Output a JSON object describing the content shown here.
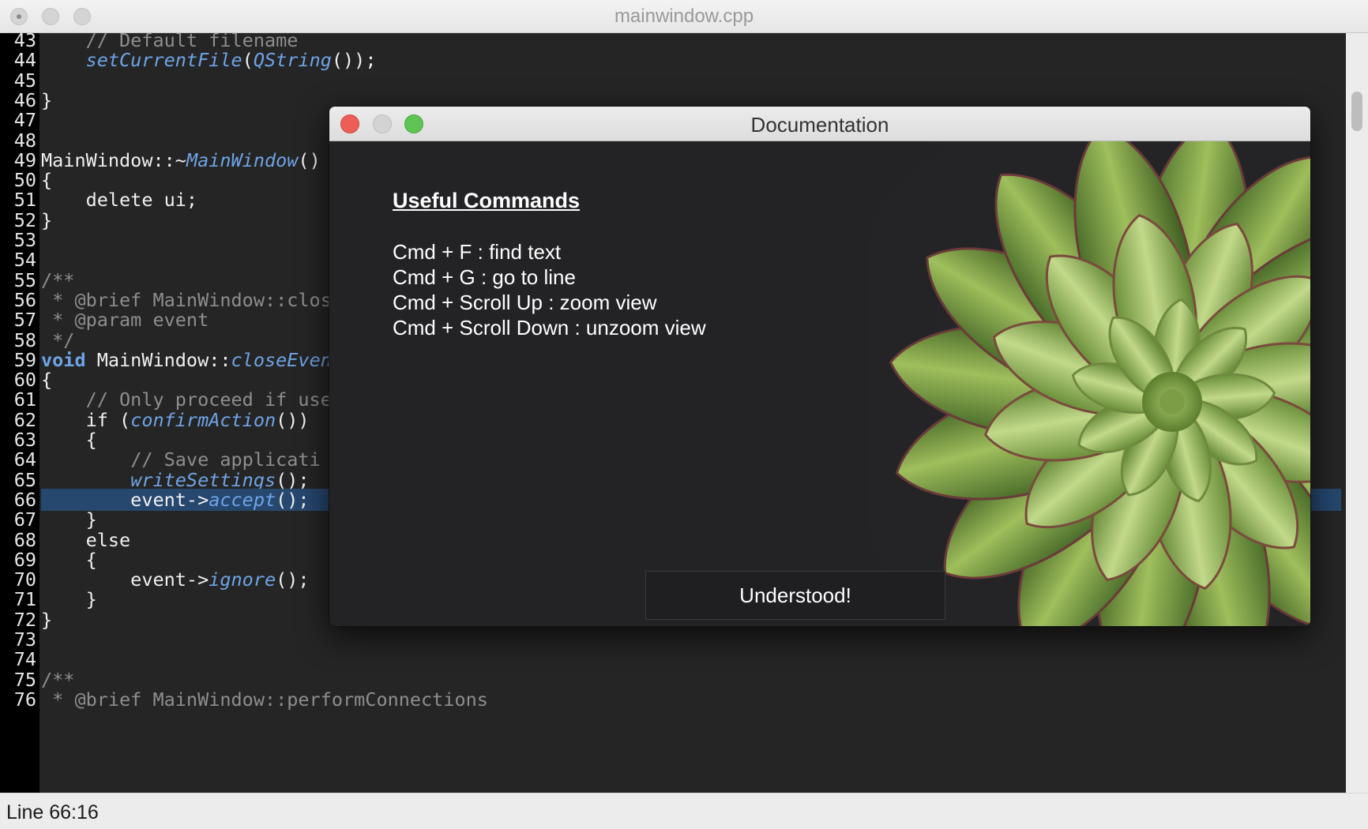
{
  "window": {
    "title": "mainwindow.cpp"
  },
  "editor": {
    "current_line": "66",
    "lines": [
      {
        "n": "43",
        "tokens": [
          [
            "plain",
            "    "
          ],
          [
            "comment",
            "// Default filename"
          ]
        ]
      },
      {
        "n": "44",
        "tokens": [
          [
            "plain",
            "    "
          ],
          [
            "fn",
            "setCurrentFile"
          ],
          [
            "plain",
            "("
          ],
          [
            "fn",
            "QString"
          ],
          [
            "plain",
            "());"
          ]
        ]
      },
      {
        "n": "45",
        "tokens": []
      },
      {
        "n": "46",
        "tokens": [
          [
            "plain",
            "}"
          ]
        ]
      },
      {
        "n": "47",
        "tokens": []
      },
      {
        "n": "48",
        "tokens": []
      },
      {
        "n": "49",
        "tokens": [
          [
            "plain",
            "MainWindow::~"
          ],
          [
            "fn",
            "MainWindow"
          ],
          [
            "plain",
            "()"
          ]
        ]
      },
      {
        "n": "50",
        "tokens": [
          [
            "plain",
            "{"
          ]
        ]
      },
      {
        "n": "51",
        "tokens": [
          [
            "plain",
            "    delete ui;"
          ]
        ]
      },
      {
        "n": "52",
        "tokens": [
          [
            "plain",
            "}"
          ]
        ]
      },
      {
        "n": "53",
        "tokens": []
      },
      {
        "n": "54",
        "tokens": []
      },
      {
        "n": "55",
        "tokens": [
          [
            "comment",
            "/**"
          ]
        ]
      },
      {
        "n": "56",
        "tokens": [
          [
            "comment",
            " * @brief MainWindow::clos"
          ]
        ]
      },
      {
        "n": "57",
        "tokens": [
          [
            "comment",
            " * @param event"
          ]
        ]
      },
      {
        "n": "58",
        "tokens": [
          [
            "comment",
            " */"
          ]
        ]
      },
      {
        "n": "59",
        "tokens": [
          [
            "kw",
            "void"
          ],
          [
            "plain",
            " MainWindow::"
          ],
          [
            "fn",
            "closeEven"
          ]
        ]
      },
      {
        "n": "60",
        "tokens": [
          [
            "plain",
            "{"
          ]
        ]
      },
      {
        "n": "61",
        "tokens": [
          [
            "plain",
            "    "
          ],
          [
            "comment",
            "// Only proceed if use"
          ]
        ]
      },
      {
        "n": "62",
        "tokens": [
          [
            "plain",
            "    if ("
          ],
          [
            "fn",
            "confirmAction"
          ],
          [
            "plain",
            "())"
          ]
        ]
      },
      {
        "n": "63",
        "tokens": [
          [
            "plain",
            "    {"
          ]
        ]
      },
      {
        "n": "64",
        "tokens": [
          [
            "plain",
            "        "
          ],
          [
            "comment",
            "// Save applicati"
          ]
        ]
      },
      {
        "n": "65",
        "tokens": [
          [
            "plain",
            "        "
          ],
          [
            "fn",
            "writeSettings"
          ],
          [
            "plain",
            "();"
          ]
        ]
      },
      {
        "n": "66",
        "tokens": [
          [
            "plain",
            "        event->"
          ],
          [
            "fn",
            "accept"
          ],
          [
            "plain",
            "();"
          ]
        ]
      },
      {
        "n": "67",
        "tokens": [
          [
            "plain",
            "    }"
          ]
        ]
      },
      {
        "n": "68",
        "tokens": [
          [
            "plain",
            "    else"
          ]
        ]
      },
      {
        "n": "69",
        "tokens": [
          [
            "plain",
            "    {"
          ]
        ]
      },
      {
        "n": "70",
        "tokens": [
          [
            "plain",
            "        event->"
          ],
          [
            "fn",
            "ignore"
          ],
          [
            "plain",
            "();"
          ]
        ]
      },
      {
        "n": "71",
        "tokens": [
          [
            "plain",
            "    }"
          ]
        ]
      },
      {
        "n": "72",
        "tokens": [
          [
            "plain",
            "}"
          ]
        ]
      },
      {
        "n": "73",
        "tokens": []
      },
      {
        "n": "74",
        "tokens": []
      },
      {
        "n": "75",
        "tokens": [
          [
            "comment",
            "/**"
          ]
        ]
      },
      {
        "n": "76",
        "tokens": [
          [
            "comment",
            " * @brief MainWindow::performConnections"
          ]
        ]
      }
    ]
  },
  "status_bar": {
    "text": "Line 66:16"
  },
  "dialog": {
    "title": "Documentation",
    "heading": "Useful Commands",
    "commands": [
      "Cmd + F : find text",
      "Cmd + G : go to line",
      "Cmd + Scroll Up : zoom view",
      "Cmd + Scroll Down : unzoom view"
    ],
    "button_label": "Understood!",
    "image": "succulent-plant-photo"
  },
  "colors": {
    "editor_bg": "#252525",
    "gutter_bg": "#000000",
    "highlight": "#26476e",
    "keyword": "#6ea4e6",
    "comment": "#8e8e8e",
    "close_btn": "#ec5f57",
    "max_btn": "#5fc454"
  }
}
